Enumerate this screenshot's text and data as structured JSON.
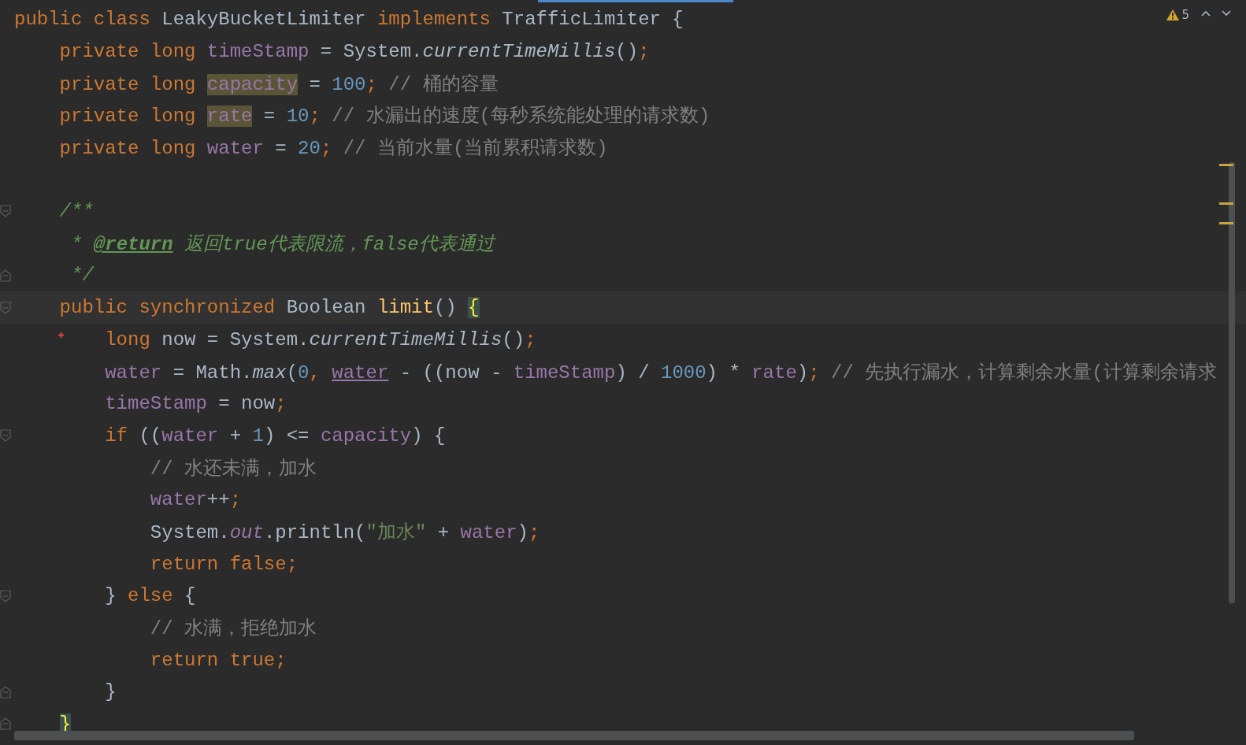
{
  "inspections": {
    "warning_count": "5"
  },
  "lines": [
    {
      "kind": "code",
      "tokens": [
        {
          "text": "public class ",
          "kind": "kw"
        },
        {
          "text": "LeakyBucketLimiter ",
          "kind": "plain"
        },
        {
          "text": "implements ",
          "kind": "kw"
        },
        {
          "text": "TrafficLimiter {",
          "kind": "plain"
        }
      ]
    },
    {
      "kind": "code",
      "tokens": [
        {
          "text": "    private long ",
          "kind": "kw"
        },
        {
          "text": "timeStamp",
          "kind": "field"
        },
        {
          "text": " = System.",
          "kind": "plain"
        },
        {
          "text": "currentTimeMillis",
          "kind": "static"
        },
        {
          "text": "()",
          "kind": "plain"
        },
        {
          "text": ";",
          "kind": "op"
        }
      ]
    },
    {
      "kind": "code",
      "tokens": [
        {
          "text": "    private long ",
          "kind": "kw"
        },
        {
          "text": "capacity",
          "kind": "field",
          "highlight": true
        },
        {
          "text": " = ",
          "kind": "plain"
        },
        {
          "text": "100",
          "kind": "num"
        },
        {
          "text": ";",
          "kind": "op"
        },
        {
          "text": " // 桶的容量",
          "kind": "comment"
        }
      ]
    },
    {
      "kind": "code",
      "tokens": [
        {
          "text": "    private long ",
          "kind": "kw"
        },
        {
          "text": "rate",
          "kind": "field",
          "highlight": true
        },
        {
          "text": " = ",
          "kind": "plain"
        },
        {
          "text": "10",
          "kind": "num"
        },
        {
          "text": ";",
          "kind": "op"
        },
        {
          "text": " // 水漏出的速度(每秒系统能处理的请求数)",
          "kind": "comment"
        }
      ]
    },
    {
      "kind": "code",
      "tokens": [
        {
          "text": "    private long ",
          "kind": "kw"
        },
        {
          "text": "water",
          "kind": "field"
        },
        {
          "text": " = ",
          "kind": "plain"
        },
        {
          "text": "20",
          "kind": "num"
        },
        {
          "text": ";",
          "kind": "op"
        },
        {
          "text": " // 当前水量(当前累积请求数)",
          "kind": "comment"
        }
      ]
    },
    {
      "kind": "blank"
    },
    {
      "kind": "code",
      "fold_start": true,
      "tokens": [
        {
          "text": "    /**",
          "kind": "doc"
        }
      ]
    },
    {
      "kind": "code",
      "tokens": [
        {
          "text": "     * ",
          "kind": "doc"
        },
        {
          "text": "@return",
          "kind": "doctag"
        },
        {
          "text": " 返回true代表限流，false代表通过",
          "kind": "doc"
        }
      ]
    },
    {
      "kind": "code",
      "fold_end": true,
      "tokens": [
        {
          "text": "     */",
          "kind": "doc"
        }
      ]
    },
    {
      "kind": "code",
      "fold_start": true,
      "current": true,
      "tokens": [
        {
          "text": "    public synchronized ",
          "kind": "kw"
        },
        {
          "text": "Boolean ",
          "kind": "plain"
        },
        {
          "text": "limit",
          "kind": "method"
        },
        {
          "text": "() ",
          "kind": "plain"
        },
        {
          "text": "{",
          "kind": "brace"
        }
      ]
    },
    {
      "kind": "code",
      "error": true,
      "tokens": [
        {
          "text": "        long",
          "kind": "kw"
        },
        {
          "text": " now = System.",
          "kind": "plain"
        },
        {
          "text": "currentTimeMillis",
          "kind": "static"
        },
        {
          "text": "()",
          "kind": "plain"
        },
        {
          "text": ";",
          "kind": "op"
        }
      ]
    },
    {
      "kind": "code",
      "tokens": [
        {
          "text": "        water",
          "kind": "field"
        },
        {
          "text": " = Math.",
          "kind": "plain"
        },
        {
          "text": "max",
          "kind": "static"
        },
        {
          "text": "(",
          "kind": "plain"
        },
        {
          "text": "0",
          "kind": "num"
        },
        {
          "text": ", ",
          "kind": "op"
        },
        {
          "text": "water",
          "kind": "field",
          "link": true
        },
        {
          "text": " - ((now - ",
          "kind": "plain"
        },
        {
          "text": "timeStamp",
          "kind": "field"
        },
        {
          "text": ") / ",
          "kind": "plain"
        },
        {
          "text": "1000",
          "kind": "num"
        },
        {
          "text": ") * ",
          "kind": "plain"
        },
        {
          "text": "rate",
          "kind": "field"
        },
        {
          "text": ")",
          "kind": "plain"
        },
        {
          "text": ";",
          "kind": "op"
        },
        {
          "text": " // 先执行漏水，计算剩余水量(计算剩余请求",
          "kind": "comment"
        }
      ]
    },
    {
      "kind": "code",
      "tokens": [
        {
          "text": "        timeStamp",
          "kind": "field"
        },
        {
          "text": " = now",
          "kind": "plain"
        },
        {
          "text": ";",
          "kind": "op"
        }
      ]
    },
    {
      "kind": "code",
      "fold_start": true,
      "tokens": [
        {
          "text": "        if ",
          "kind": "kw"
        },
        {
          "text": "((",
          "kind": "plain"
        },
        {
          "text": "water",
          "kind": "field"
        },
        {
          "text": " + ",
          "kind": "plain"
        },
        {
          "text": "1",
          "kind": "num"
        },
        {
          "text": ") <= ",
          "kind": "plain"
        },
        {
          "text": "capacity",
          "kind": "field"
        },
        {
          "text": ") {",
          "kind": "plain"
        }
      ]
    },
    {
      "kind": "code",
      "tokens": [
        {
          "text": "            // 水还未满，加水",
          "kind": "comment"
        }
      ]
    },
    {
      "kind": "code",
      "tokens": [
        {
          "text": "            water",
          "kind": "field"
        },
        {
          "text": "++",
          "kind": "plain"
        },
        {
          "text": ";",
          "kind": "op"
        }
      ]
    },
    {
      "kind": "code",
      "tokens": [
        {
          "text": "            System.",
          "kind": "plain"
        },
        {
          "text": "out",
          "kind": "staticfield"
        },
        {
          "text": ".println(",
          "kind": "plain"
        },
        {
          "text": "\"加水\"",
          "kind": "string"
        },
        {
          "text": " + ",
          "kind": "plain"
        },
        {
          "text": "water",
          "kind": "field"
        },
        {
          "text": ")",
          "kind": "plain"
        },
        {
          "text": ";",
          "kind": "op"
        }
      ]
    },
    {
      "kind": "code",
      "tokens": [
        {
          "text": "            return false;",
          "kind": "kw"
        }
      ]
    },
    {
      "kind": "code",
      "fold_start": true,
      "tokens": [
        {
          "text": "        } ",
          "kind": "plain"
        },
        {
          "text": "else ",
          "kind": "kw"
        },
        {
          "text": "{",
          "kind": "plain"
        }
      ]
    },
    {
      "kind": "code",
      "tokens": [
        {
          "text": "            // 水满，拒绝加水",
          "kind": "comment"
        }
      ]
    },
    {
      "kind": "code",
      "tokens": [
        {
          "text": "            return true;",
          "kind": "kw"
        }
      ]
    },
    {
      "kind": "code",
      "fold_end": true,
      "tokens": [
        {
          "text": "        }",
          "kind": "plain"
        }
      ]
    },
    {
      "kind": "code",
      "fold_end": true,
      "tokens": [
        {
          "text": "    }",
          "kind": "brace"
        }
      ]
    }
  ]
}
